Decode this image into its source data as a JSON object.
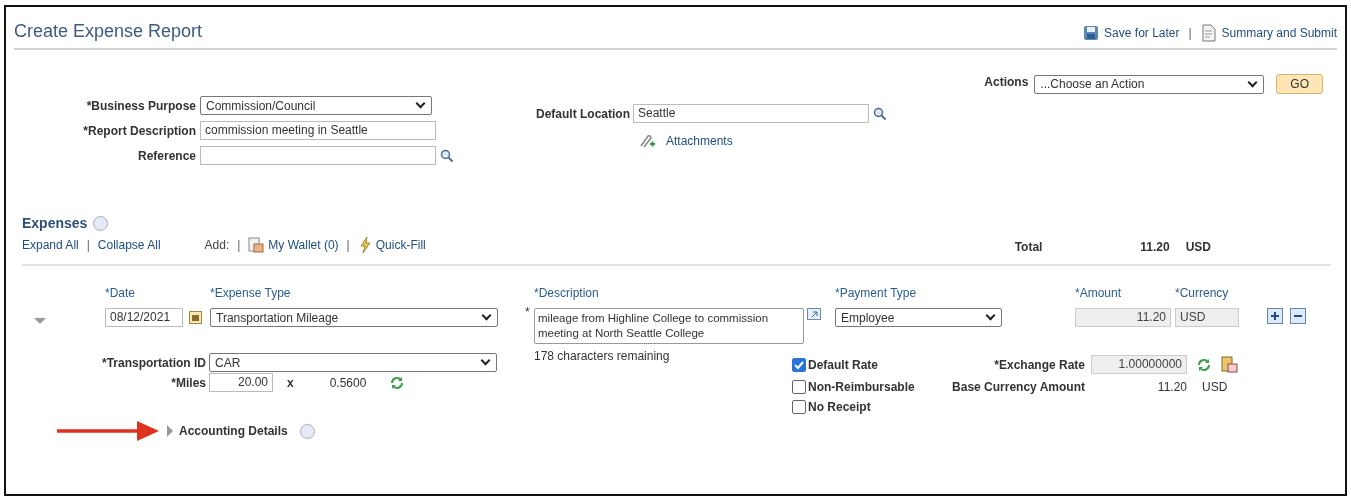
{
  "header": {
    "title": "Create Expense Report",
    "links": [
      "Save for Later",
      "Summary and Submit"
    ],
    "separator": "|"
  },
  "report": {
    "business_purpose": {
      "label": "*Business Purpose",
      "value": "Commission/Council"
    },
    "report_description": {
      "label": "*Report Description",
      "value": "commission meeting in Seattle"
    },
    "reference": {
      "label": "Reference"
    },
    "default_location": {
      "label": "Default Location",
      "value": "Seattle"
    },
    "attachments": "Attachments",
    "actions": {
      "label": "Actions",
      "value": "...Choose an Action"
    },
    "go_button": "GO"
  },
  "expenses": {
    "title": "Expenses",
    "links": [
      "Expand All",
      "Collapse All"
    ],
    "link_separator": "|",
    "add_label": "Add:",
    "add_separators": [
      "|",
      "|"
    ],
    "add_links": [
      "My Wallet (0)",
      "Quick-Fill"
    ],
    "total": {
      "label": "Total",
      "amount": "11.20",
      "currency": "USD"
    }
  },
  "expense_line": {
    "expanded": true,
    "date": {
      "label": "*Date",
      "value": "08/12/2021"
    },
    "expense_type": {
      "label": "*Expense Type",
      "value": "Transportation Mileage"
    },
    "description": {
      "label": "*Description",
      "required_mark": "*",
      "value": "mileage from Highline College to commission meeting at North Seattle College",
      "remaining": "178 characters remaining"
    },
    "payment_type": {
      "label": "*Payment Type",
      "value": "Employee"
    },
    "amount": {
      "label": "*Amount",
      "value": "11.20"
    },
    "currency": {
      "label": "*Currency",
      "value": "USD"
    },
    "transportation_id": {
      "label": "*Transportation ID",
      "value": "CAR"
    },
    "miles": {
      "label": "*Miles",
      "value": "20.00",
      "times": "x",
      "rate": "0.5600"
    },
    "checkboxes": [
      {
        "label": "Default Rate",
        "checked": true
      },
      {
        "label": "Non-Reimbursable",
        "checked": false
      },
      {
        "label": "No Receipt",
        "checked": false
      }
    ],
    "exchange_rate": {
      "label": "*Exchange Rate",
      "value": "1.00000000"
    },
    "base_currency": {
      "label": "Base Currency Amount",
      "amount": "11.20",
      "currency": "USD"
    },
    "accounting_details": {
      "label": "Accounting Details",
      "expanded": false
    }
  }
}
